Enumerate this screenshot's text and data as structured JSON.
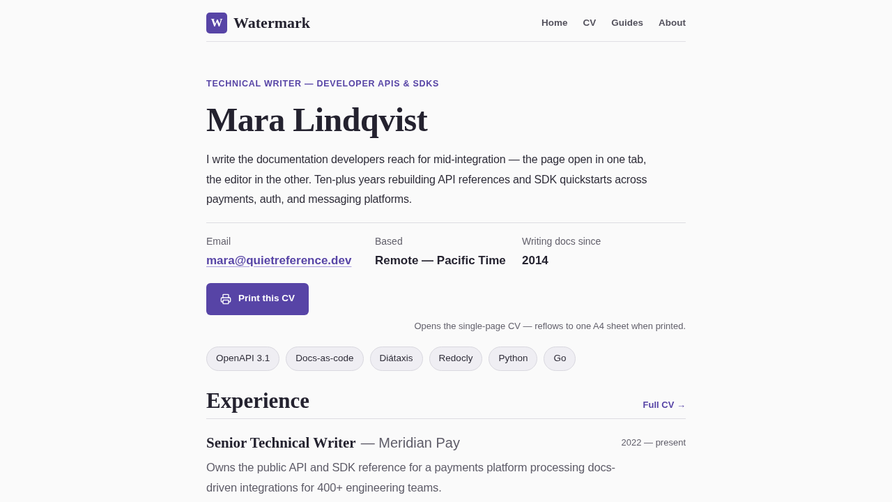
{
  "header": {
    "logo": {
      "letter": "W",
      "name": "Watermark"
    },
    "nav": [
      {
        "label": "Home"
      },
      {
        "label": "CV"
      },
      {
        "label": "Guides"
      },
      {
        "label": "About"
      }
    ]
  },
  "hero": {
    "eyebrow": "TECHNICAL WRITER — DEVELOPER APIS & SDKS",
    "name": "Mara Lindqvist",
    "intro": "I write the documentation developers reach for mid-integration — the page open in one tab, the editor in the other. Ten-plus years rebuilding API references and SDK quickstarts across payments, auth, and messaging platforms."
  },
  "details": [
    {
      "label": "Email",
      "value": "mara@quietreference.dev",
      "kind": "link"
    },
    {
      "label": "Based",
      "value": "Remote — Pacific Time",
      "kind": "text"
    },
    {
      "label": "Writing docs since",
      "value": "2014",
      "kind": "text"
    }
  ],
  "print_button": {
    "label": "Print this CV"
  },
  "print_note": "Opens the single-page CV — reflows to one A4 sheet when printed.",
  "tags": [
    "OpenAPI 3.1",
    "Docs-as-code",
    "Diátaxis",
    "Redocly",
    "Python",
    "Go"
  ],
  "experience": {
    "title": "Experience",
    "link": "Full CV →",
    "jobs": [
      {
        "title": "Senior Technical Writer",
        "company": "— Meridian Pay",
        "dates": "2022 — present",
        "description": "Owns the public API and SDK reference for a payments platform processing docs-driven integrations for 400+ engineering teams."
      }
    ]
  }
}
